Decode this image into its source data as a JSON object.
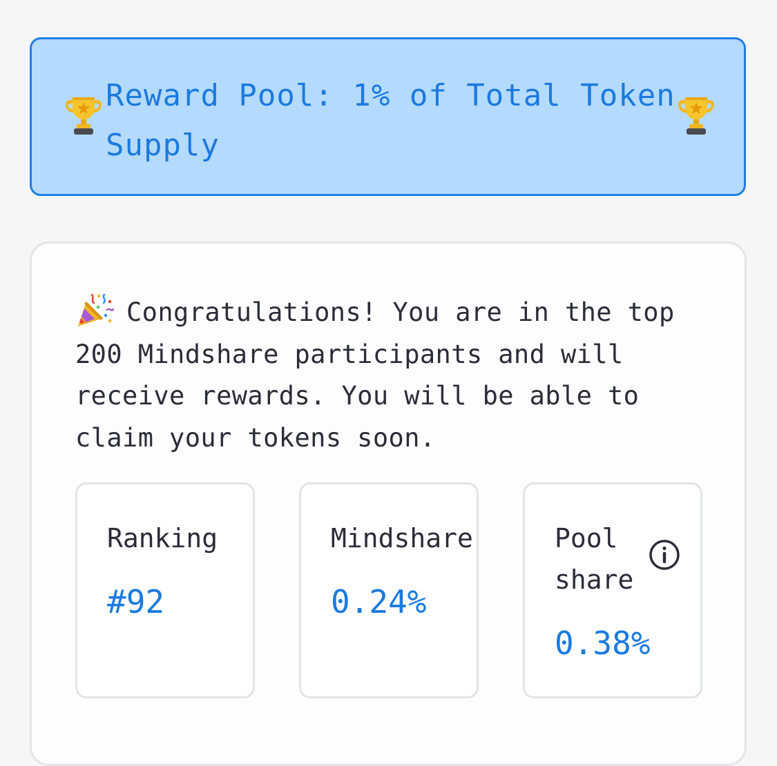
{
  "banner": {
    "text": "Reward Pool: 1% of Total Token Supply",
    "icon_left": "trophy-icon",
    "icon_right": "trophy-icon",
    "background": "#b5daff",
    "accent": "#1a7ae0"
  },
  "congrats": {
    "icon": "party-popper-icon",
    "text": "Congratulations! You are in the top 200 Mindshare participants and will receive rewards. You will be able to claim your tokens soon."
  },
  "stats": [
    {
      "label": "Ranking",
      "value": "#92"
    },
    {
      "label": "Mindshare",
      "value": "0.24%"
    },
    {
      "label": "Pool share",
      "value": "0.38%",
      "icon": "info-icon"
    }
  ],
  "colors": {
    "accent_blue": "#1a7ae0",
    "text_dark": "#2c2c38",
    "card_border": "#e4e5ea"
  }
}
